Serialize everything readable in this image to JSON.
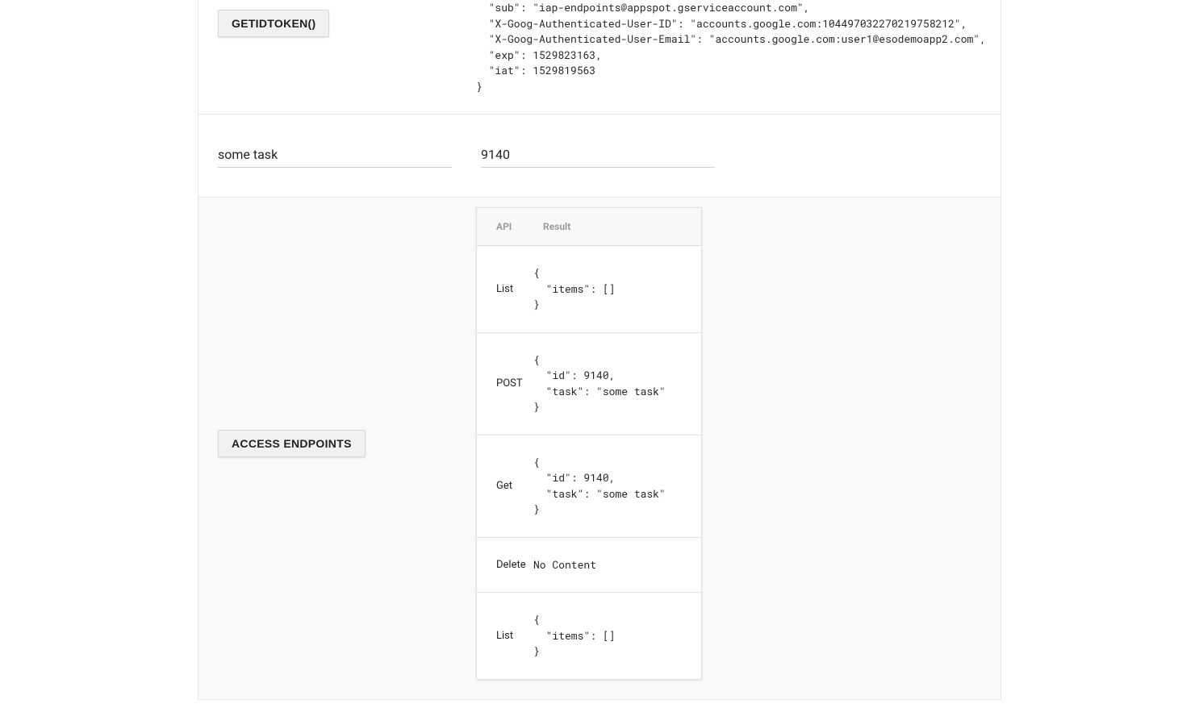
{
  "token_section": {
    "button_label": "GetIdToken()",
    "code": "  \"sub\": \"iap-endpoints@appspot.gserviceaccount.com\",\n  \"X-Goog-Authenticated-User-ID\": \"accounts.google.com:104497032270219758212\",\n  \"X-Goog-Authenticated-User-Email\": \"accounts.google.com:user1@esodemoapp2.com\",\n  \"exp\": 1529823163,\n  \"iat\": 1529819563\n}"
  },
  "inputs": {
    "task_value": "some task",
    "id_value": "9140"
  },
  "endpoints_section": {
    "button_label": "Access Endpoints",
    "table": {
      "headers": {
        "api": "API",
        "result": "Result"
      },
      "rows": [
        {
          "api": "List",
          "result": "{\n  \"items\": []\n}"
        },
        {
          "api": "POST",
          "result": "{\n  \"id\": 9140,\n  \"task\": \"some task\"\n}"
        },
        {
          "api": "Get",
          "result": "{\n  \"id\": 9140,\n  \"task\": \"some task\"\n}"
        },
        {
          "api": "Delete",
          "result": "No Content"
        },
        {
          "api": "List",
          "result": "{\n  \"items\": []\n}"
        }
      ]
    }
  }
}
